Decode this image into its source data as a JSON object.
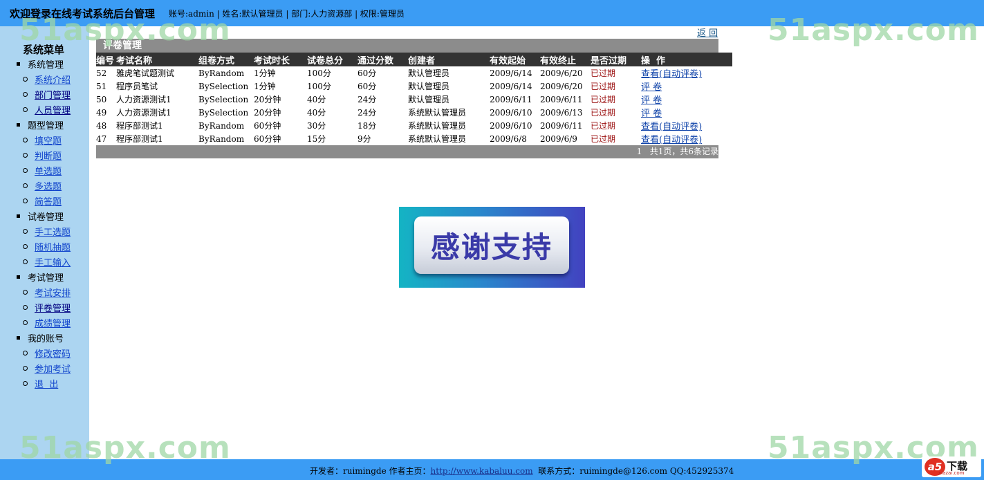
{
  "header": {
    "title": "欢迎登录在线考试系统后台管理",
    "user_info": "账号:admin | 姓名:默认管理员 | 部门:人力资源部 | 权限:管理员"
  },
  "watermark": "51aspx.com",
  "sidebar": {
    "title": "系统菜单",
    "groups": [
      {
        "label": "系统管理",
        "items": [
          "系统介绍",
          "部门管理",
          "人员管理"
        ]
      },
      {
        "label": "题型管理",
        "items": [
          "填空题",
          "判断题",
          "单选题",
          "多选题",
          "简答题"
        ]
      },
      {
        "label": "试卷管理",
        "items": [
          "手工选题",
          "随机抽题",
          "手工输入"
        ]
      },
      {
        "label": "考试管理",
        "items": [
          "考试安排",
          "评卷管理",
          "成绩管理"
        ]
      },
      {
        "label": "我的账号",
        "items": [
          "修改密码",
          "参加考试",
          "退  出"
        ]
      }
    ]
  },
  "back_link": "返 回",
  "panel": {
    "title": "评卷管理",
    "columns": [
      "编号",
      "考试名称",
      "组卷方式",
      "考试时长",
      "试卷总分",
      "通过分数",
      "创建者",
      "有效起始",
      "有效终止",
      "是否过期",
      "操  作"
    ],
    "rows": [
      [
        "52",
        "雅虎笔试题测试",
        "ByRandom",
        "1分钟",
        "100分",
        "60分",
        "默认管理员",
        "2009/6/14",
        "2009/6/20",
        "已过期",
        "查看(自动评卷)"
      ],
      [
        "51",
        "程序员笔试",
        "BySelection",
        "1分钟",
        "100分",
        "60分",
        "默认管理员",
        "2009/6/14",
        "2009/6/20",
        "已过期",
        "评 卷"
      ],
      [
        "50",
        "人力资源测试1",
        "BySelection",
        "20分钟",
        "40分",
        "24分",
        "默认管理员",
        "2009/6/11",
        "2009/6/11",
        "已过期",
        "评 卷"
      ],
      [
        "49",
        "人力资源测试1",
        "BySelection",
        "20分钟",
        "40分",
        "24分",
        "系统默认管理员",
        "2009/6/10",
        "2009/6/13",
        "已过期",
        "评 卷"
      ],
      [
        "48",
        "程序部测试1",
        "ByRandom",
        "60分钟",
        "30分",
        "18分",
        "系统默认管理员",
        "2009/6/10",
        "2009/6/11",
        "已过期",
        "查看(自动评卷)"
      ],
      [
        "47",
        "程序部测试1",
        "ByRandom",
        "60分钟",
        "15分",
        "9分",
        "系统默认管理员",
        "2009/6/8",
        "2009/6/9",
        "已过期",
        "查看(自动评卷)"
      ]
    ],
    "pager": "1   共1页，共6条记录"
  },
  "banner": {
    "text": "感谢支持"
  },
  "footer": {
    "developer_label": "开发者：ruimingde  作者主页：",
    "homepage": "http://www.kabaluu.com",
    "contact": "  联系方式：ruimingde@126.com QQ:452925374"
  },
  "logo": {
    "badge": "a5",
    "text": "下载",
    "sub": "xiazai.com"
  }
}
